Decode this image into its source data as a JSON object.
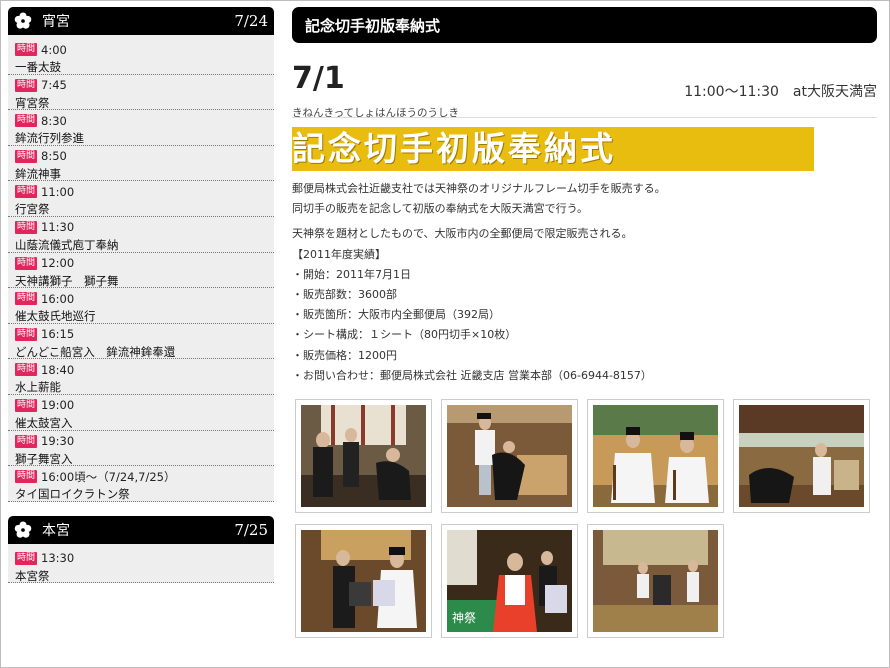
{
  "sidebar": {
    "sections": [
      {
        "name": "宵宮",
        "date": "7/24",
        "items": [
          {
            "badge": "時間",
            "time": "4:00",
            "event": "一番太鼓"
          },
          {
            "badge": "時間",
            "time": "7:45",
            "event": "宵宮祭"
          },
          {
            "badge": "時間",
            "time": "8:30",
            "event": "鉾流行列参進"
          },
          {
            "badge": "時間",
            "time": "8:50",
            "event": "鉾流神事"
          },
          {
            "badge": "時間",
            "time": "11:00",
            "event": "行宮祭"
          },
          {
            "badge": "時間",
            "time": "11:30",
            "event": "山蔭流儀式庖丁奉納"
          },
          {
            "badge": "時間",
            "time": "12:00",
            "event": "天神講獅子　獅子舞"
          },
          {
            "badge": "時間",
            "time": "16:00",
            "event": "催太鼓氏地巡行"
          },
          {
            "badge": "時間",
            "time": "16:15",
            "event": "どんどこ船宮入　鉾流神鉾奉還"
          },
          {
            "badge": "時間",
            "time": "18:40",
            "event": "水上薪能"
          },
          {
            "badge": "時間",
            "time": "19:00",
            "event": "催太鼓宮入"
          },
          {
            "badge": "時間",
            "time": "19:30",
            "event": "獅子舞宮入"
          },
          {
            "badge": "時間",
            "time": "16:00頃～（7/24,7/25）",
            "event": "タイ国ロイクラトン祭"
          }
        ]
      },
      {
        "name": "本宮",
        "date": "7/25",
        "items": [
          {
            "badge": "時間",
            "time": "13:30",
            "event": "本宮祭"
          }
        ]
      }
    ]
  },
  "main": {
    "title": "記念切手初版奉納式",
    "date": "7/1",
    "reading": "きねんきってしょはんほうのうしき",
    "when": "11:00～11:30　at大阪天満宮",
    "banner": "記念切手初版奉納式",
    "paragraph1": "郵便局株式会社近畿支社では天神祭のオリジナルフレーム切手を販売する。",
    "paragraph2": "同切手の販売を記念して初版の奉納式を大阪天満宮で行う。",
    "paragraph3": "天神祭を題材としたもので、大阪市内の全郵便局で限定販売される。",
    "record_head": "【2011年度実績】",
    "records": [
      "・開始：2011年7月1日",
      "・販売部数：3600部",
      "・販売箇所：大阪市内全郵便局（392局）",
      "・シート構成：１シート（80円切手×10枚）",
      "・販売価格：1200円",
      "・お問い合わせ：郵便局株式会社 近畿支店 営業本部（06-6944-8157）"
    ],
    "photos": [
      {
        "icon": "photo-ceremony-bow"
      },
      {
        "icon": "photo-priest-bow"
      },
      {
        "icon": "photo-priests-seated"
      },
      {
        "icon": "photo-offering"
      },
      {
        "icon": "photo-presentation"
      },
      {
        "icon": "photo-woman-red"
      },
      {
        "icon": "photo-shrine-hall"
      }
    ]
  },
  "colors": {
    "header_bg": "#000000",
    "badge": "#e3245d",
    "banner": "#e8bd0f",
    "sidebar_bg": "#eeeeee"
  }
}
